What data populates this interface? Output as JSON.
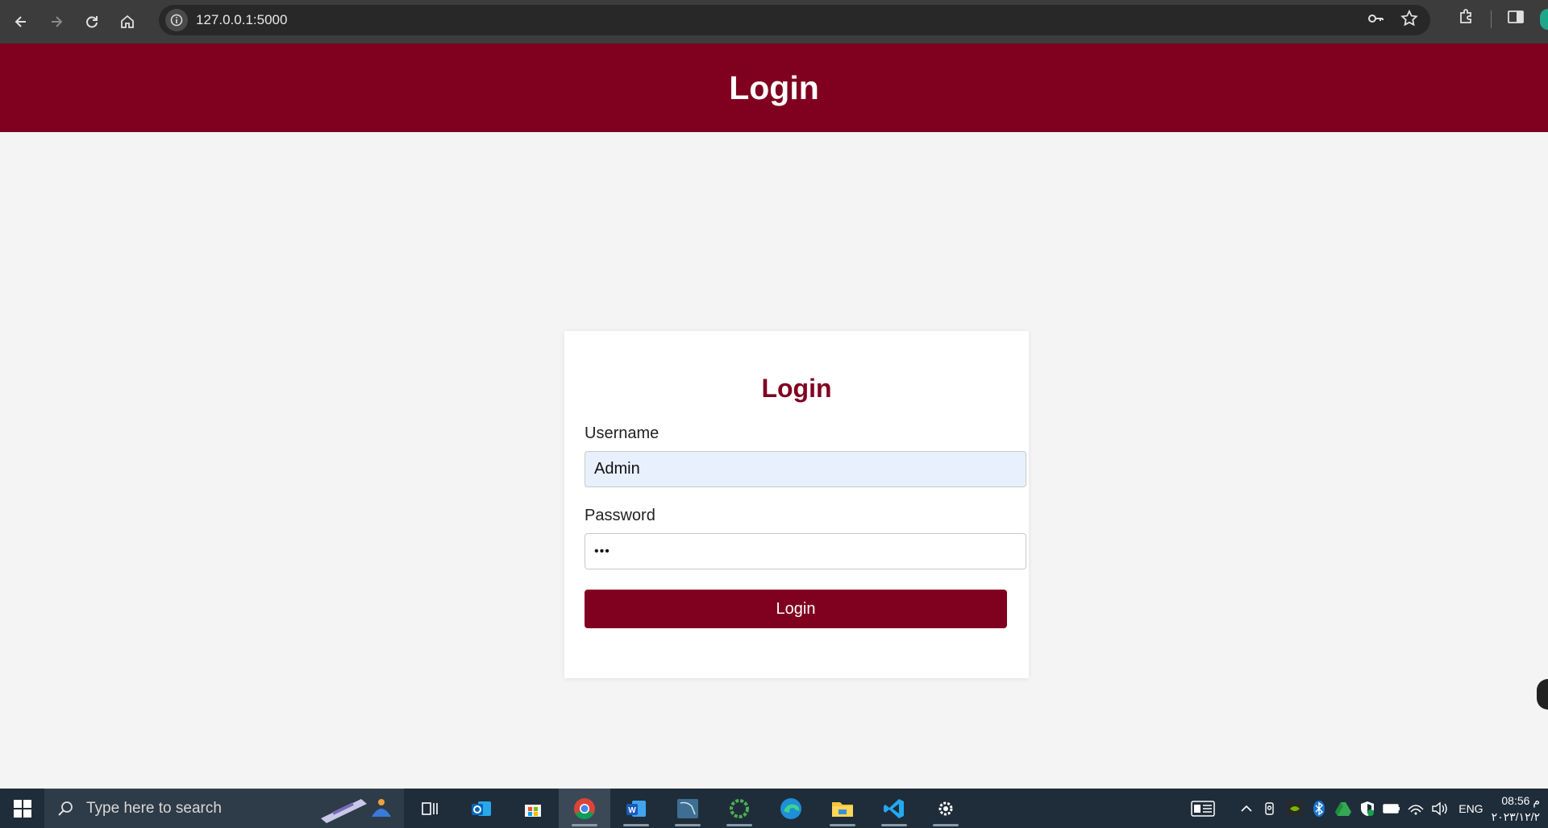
{
  "browser": {
    "url": "127.0.0.1:5000"
  },
  "header": {
    "title": "Login"
  },
  "login_form": {
    "title": "Login",
    "username_label": "Username",
    "username_value": "Admin",
    "password_label": "Password",
    "password_value": "•••",
    "submit_label": "Login"
  },
  "taskbar": {
    "search_placeholder": "Type here to search",
    "apps": [
      "task-view",
      "outlook",
      "microsoft-store",
      "chrome",
      "word",
      "mysql-workbench",
      "ring-app",
      "edge",
      "file-explorer",
      "vscode",
      "settings"
    ],
    "language": "ENG",
    "time": "08:56 م",
    "date": "٢٠٢٣/١٢/٢"
  },
  "colors": {
    "brand": "#800020",
    "page_bg": "#f4f4f4",
    "autofill_bg": "#e8f0fe"
  }
}
